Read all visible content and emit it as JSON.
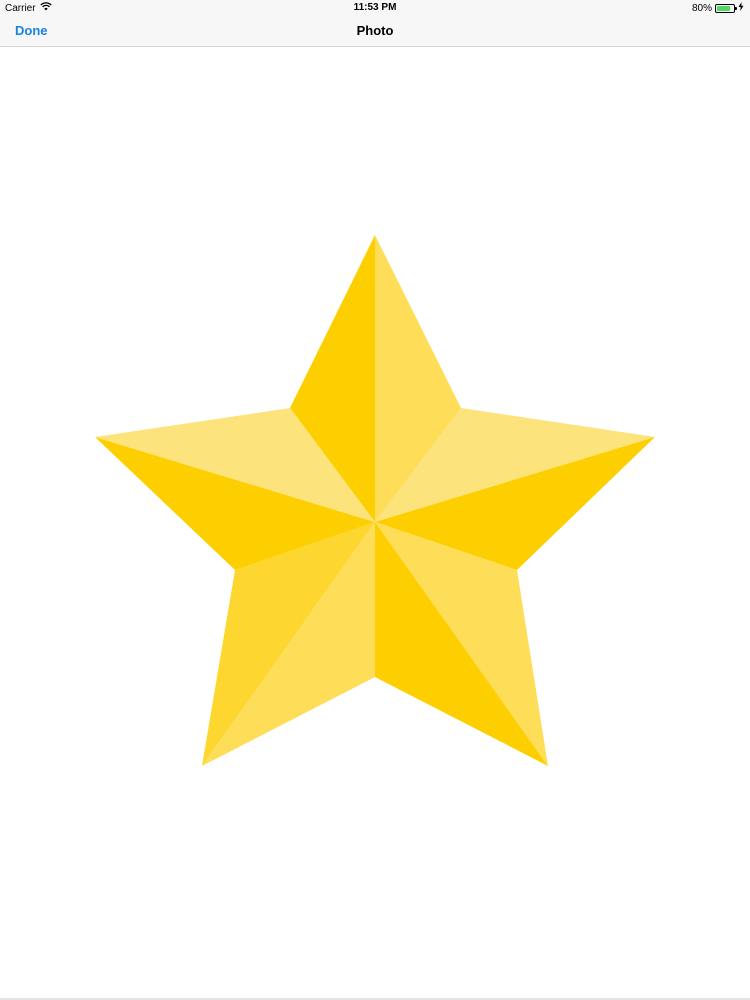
{
  "status_bar": {
    "carrier": "Carrier",
    "time": "11:53 PM",
    "battery_percent": "80%",
    "battery_level": 0.8,
    "icons": [
      "wifi-icon",
      "battery-icon",
      "charging-bolt-icon"
    ]
  },
  "nav_bar": {
    "done_label": "Done",
    "title": "Photo",
    "accent_color": "#1a82e2"
  },
  "photo": {
    "subject": "star-icon",
    "colors": {
      "light": "#fde37c",
      "mid": "#fedd58",
      "mid_dark": "#fdd630",
      "dark": "#fecf00"
    }
  }
}
